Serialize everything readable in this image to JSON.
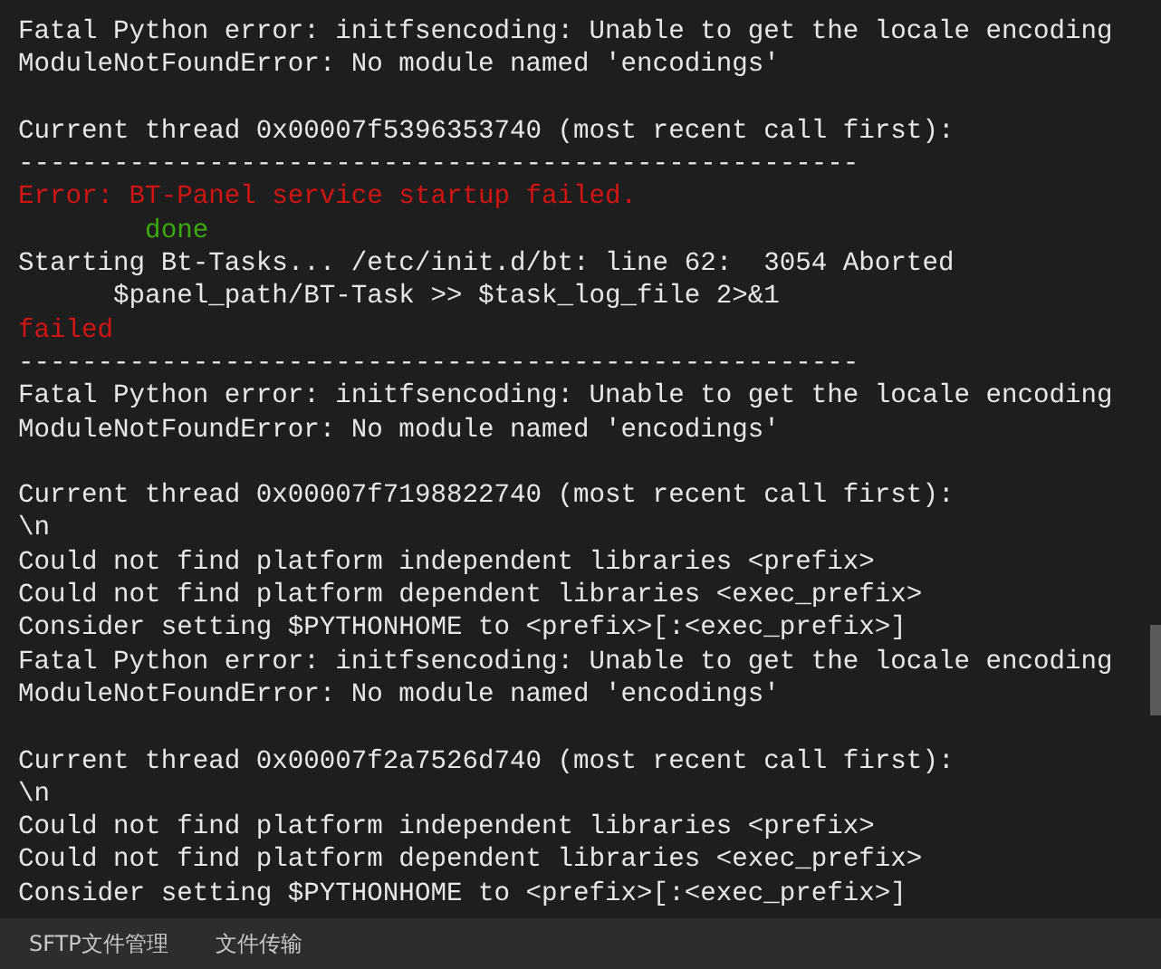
{
  "terminal": {
    "lines": [
      {
        "kind": "output",
        "text": "Fatal Python error: initfsencoding: Unable to get the locale encoding"
      },
      {
        "kind": "output",
        "text": "ModuleNotFoundError: No module named 'encodings'"
      },
      {
        "kind": "blank"
      },
      {
        "kind": "output",
        "text": "Current thread 0x00007f5396353740 (most recent call first):"
      },
      {
        "kind": "output",
        "text": "-----------------------------------------------------"
      },
      {
        "kind": "error",
        "text": "Error: BT-Panel service startup failed."
      },
      {
        "kind": "success",
        "text": "        done"
      },
      {
        "kind": "output",
        "text": "Starting Bt-Tasks... /etc/init.d/bt: line 62:  3054 Aborted"
      },
      {
        "kind": "output",
        "text": "      $panel_path/BT-Task >> $task_log_file 2>&1"
      },
      {
        "kind": "error",
        "text": "failed"
      },
      {
        "kind": "output",
        "text": "-----------------------------------------------------"
      },
      {
        "kind": "output",
        "text": "Fatal Python error: initfsencoding: Unable to get the locale encoding"
      },
      {
        "kind": "output",
        "text": "ModuleNotFoundError: No module named 'encodings'"
      },
      {
        "kind": "blank"
      },
      {
        "kind": "output",
        "text": "Current thread 0x00007f7198822740 (most recent call first):"
      },
      {
        "kind": "output",
        "text": "\\n"
      },
      {
        "kind": "output",
        "text": "Could not find platform independent libraries <prefix>"
      },
      {
        "kind": "output",
        "text": "Could not find platform dependent libraries <exec_prefix>"
      },
      {
        "kind": "output",
        "text": "Consider setting $PYTHONHOME to <prefix>[:<exec_prefix>]"
      },
      {
        "kind": "output",
        "text": "Fatal Python error: initfsencoding: Unable to get the locale encoding"
      },
      {
        "kind": "output",
        "text": "ModuleNotFoundError: No module named 'encodings'"
      },
      {
        "kind": "blank"
      },
      {
        "kind": "output",
        "text": "Current thread 0x00007f2a7526d740 (most recent call first):"
      },
      {
        "kind": "output",
        "text": "\\n"
      },
      {
        "kind": "output",
        "text": "Could not find platform independent libraries <prefix>"
      },
      {
        "kind": "output",
        "text": "Could not find platform dependent libraries <exec_prefix>"
      },
      {
        "kind": "output",
        "text": "Consider setting $PYTHONHOME to <prefix>[:<exec_prefix>]"
      }
    ]
  },
  "bottom_tabs": [
    {
      "label": "SFTP文件管理"
    },
    {
      "label": "文件传输"
    }
  ]
}
